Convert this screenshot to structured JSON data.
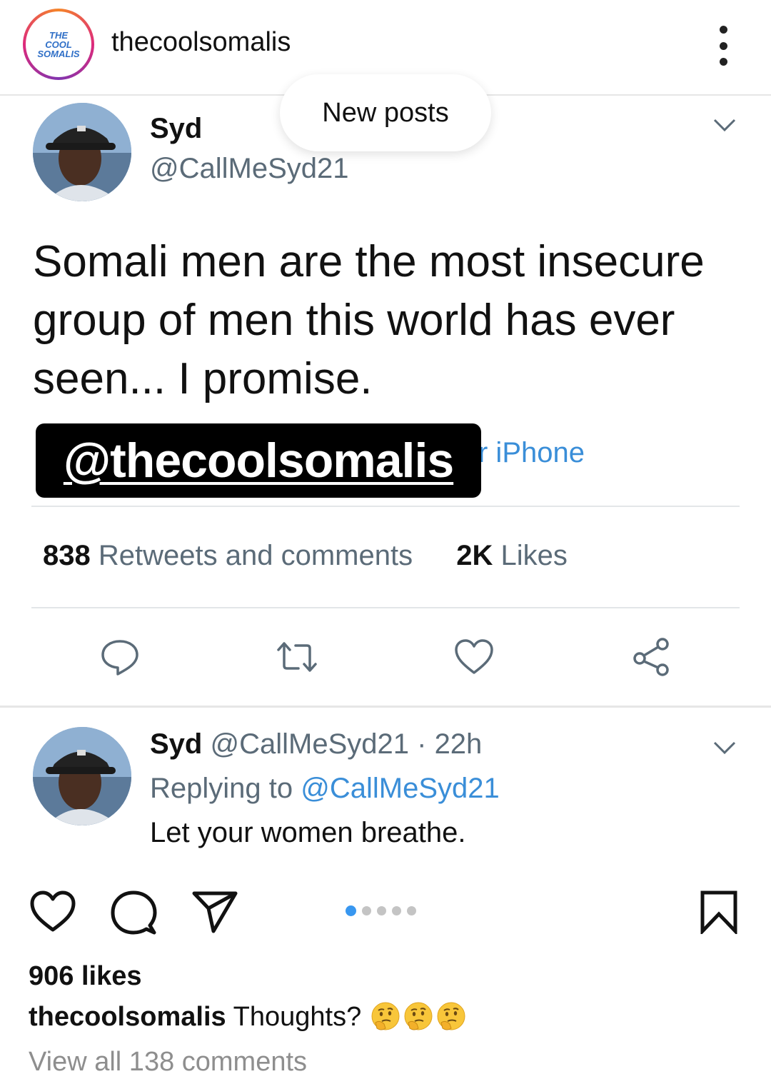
{
  "ig_header": {
    "avatar_logo_lines": [
      "THE",
      "COOL",
      "SOMALIS"
    ],
    "username": "thecoolsomalis",
    "more_icon": "more-vertical-icon"
  },
  "new_posts_pill": "New posts",
  "tweet": {
    "author_name": "Syd",
    "author_handle": "@CallMeSyd21",
    "text": "Somali men are the most insecure group of men this world has ever seen... I promise.",
    "source_visible": "r iPhone",
    "watermark": "@thecoolsomalis",
    "stats": {
      "retweets_count": "838",
      "retweets_label": "Retweets and comments",
      "likes_count": "2K",
      "likes_label": "Likes"
    },
    "actions": [
      "comment-icon",
      "retweet-icon",
      "like-icon",
      "share-icon"
    ]
  },
  "reply": {
    "author_name": "Syd",
    "author_handle": "@CallMeSyd21",
    "separator": "·",
    "time": "22h",
    "replying_prefix": "Replying to",
    "replying_handle": "@CallMeSyd21",
    "text": "Let your women breathe."
  },
  "ig_post": {
    "carousel": {
      "total": 5,
      "active_index": 0
    },
    "likes": "906 likes",
    "caption_user": "thecoolsomalis",
    "caption_text": "Thoughts?",
    "caption_emoji": [
      "thinking-face",
      "thinking-face",
      "thinking-face"
    ],
    "view_comments": "View all 138 comments"
  },
  "colors": {
    "link_blue": "#3a8ed8",
    "secondary_text": "#5b6b78",
    "carousel_active": "#3897f0"
  }
}
